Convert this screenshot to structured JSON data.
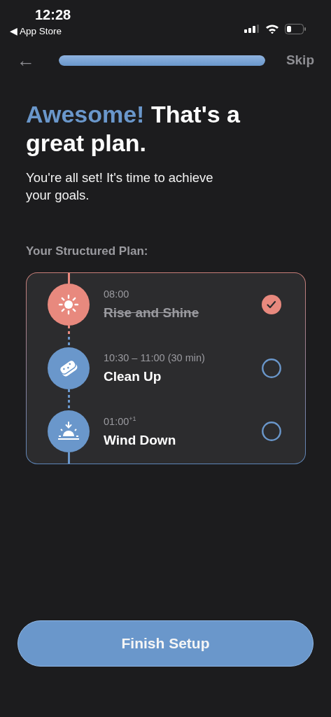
{
  "status_bar": {
    "time": "12:28",
    "back_app": "◀ App Store"
  },
  "nav": {
    "back": "←",
    "progress": {
      "level": 1
    },
    "skip": "Skip"
  },
  "heading": {
    "accent": "Awesome!",
    "rest": "That's a great plan."
  },
  "subtitle": "You're all set! It's time to achieve your goals.",
  "plan_label": "Your Structured Plan:",
  "plan": [
    {
      "kind": "sun",
      "time": "08:00",
      "title": "Rise and Shine",
      "checked": true,
      "color": "#e8897e"
    },
    {
      "kind": "sponge",
      "time": "10:30 – 11:00 (30 min)",
      "title": "Clean Up",
      "checked": false,
      "color": "#6a97cb"
    },
    {
      "kind": "sunset",
      "time": "01:00$^{+1}$",
      "title": "Wind Down",
      "checked": false,
      "color": "#6a97cb"
    }
  ],
  "button": "Finish Setup"
}
